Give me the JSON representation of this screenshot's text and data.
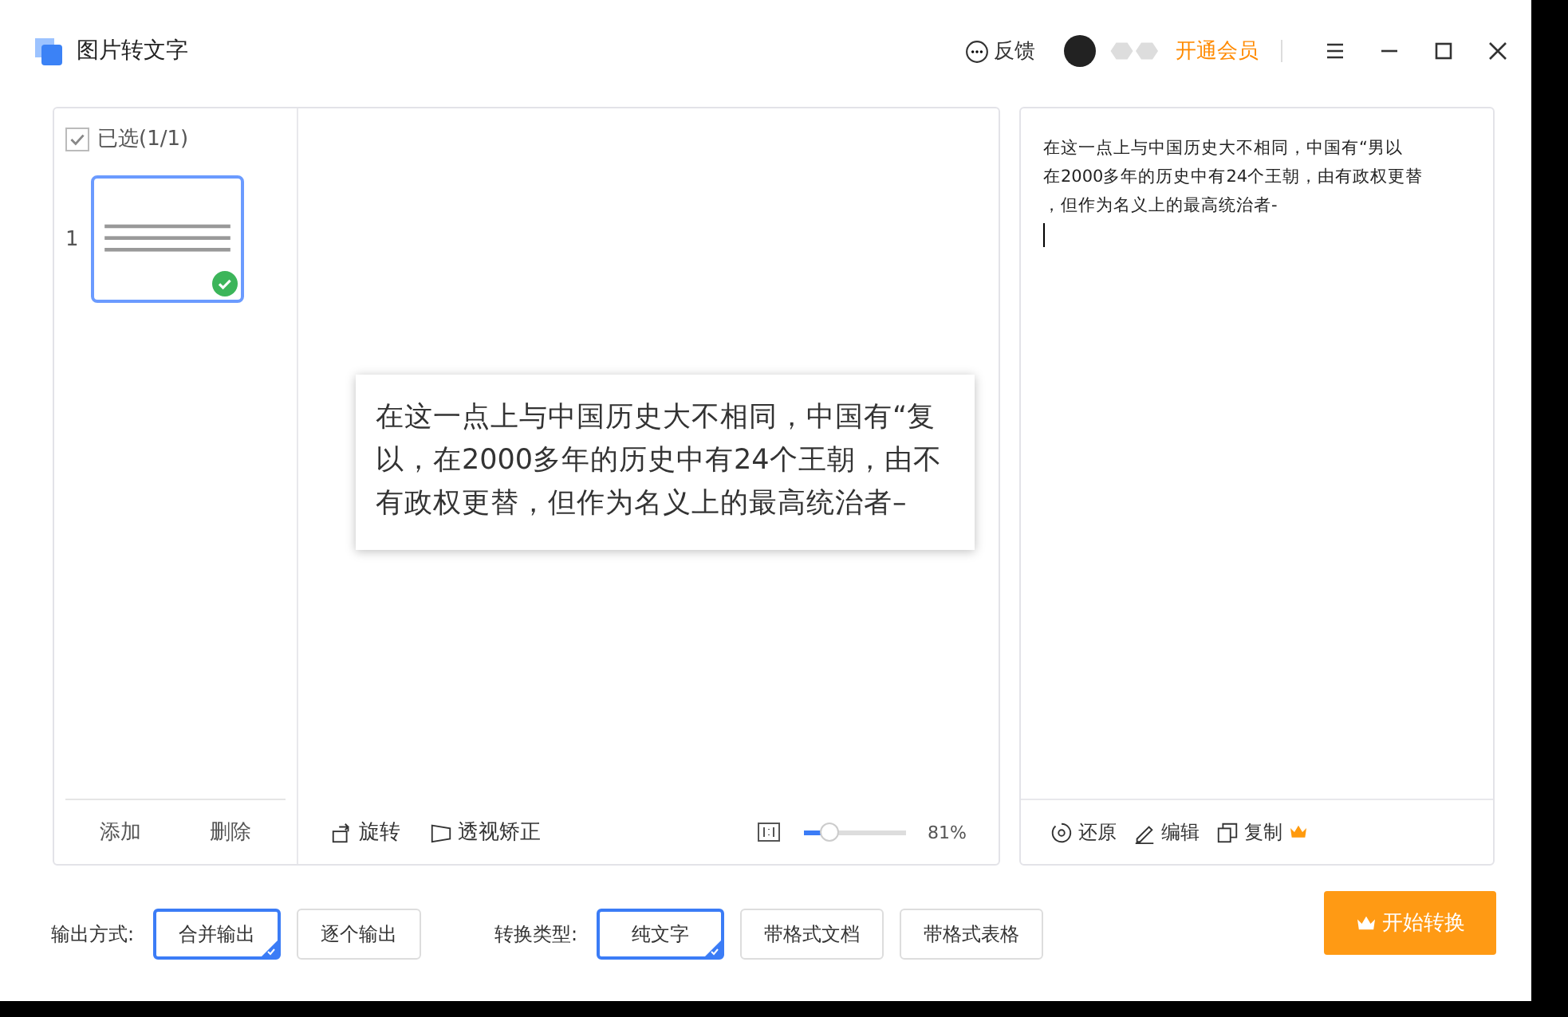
{
  "window": {
    "title": "图片转文字",
    "feedback": "反馈",
    "vip": "开通会员"
  },
  "files": {
    "select_all": {
      "label": "已选(1/1)",
      "checked": true
    },
    "items": [
      {
        "index": "1",
        "selected": true,
        "done": true
      }
    ],
    "actions": [
      "添加",
      "删除"
    ]
  },
  "preview": {
    "lines": [
      "在这一点上与中国历史大不相同，中国有“复",
      "以，在2000多年的历史中有24个王朝，由不",
      "有政权更替，但作为名义上的最高统治者–"
    ],
    "tools": [
      {
        "kind": "rotate",
        "label": "旋转"
      },
      {
        "kind": "perspective",
        "label": "透视矫正"
      }
    ],
    "zoom": {
      "level": 0.2,
      "reading": "81%"
    }
  },
  "result": {
    "lines": [
      "在这一点上与中国历史大不相同，中国有“男以",
      "在2000多年的历史中有24个王朝，由有政权更替",
      "，但作为名义上的最高统治者-"
    ],
    "actions": [
      {
        "kind": "restore",
        "label": "还原"
      },
      {
        "kind": "edit",
        "label": "编辑"
      },
      {
        "kind": "copy",
        "label": "复制",
        "premium": true
      }
    ]
  },
  "output_mode": {
    "label": "输出方式:",
    "options": [
      {
        "label": "合并输出",
        "selected": true
      },
      {
        "label": "逐个输出",
        "selected": false
      }
    ]
  },
  "convert_type": {
    "label": "转换类型:",
    "options": [
      {
        "label": "纯文字",
        "selected": true
      },
      {
        "label": "带格式文档",
        "selected": false
      },
      {
        "label": "带格式表格",
        "selected": false
      }
    ]
  },
  "start_button": {
    "label": "开始转换",
    "premium": true
  }
}
